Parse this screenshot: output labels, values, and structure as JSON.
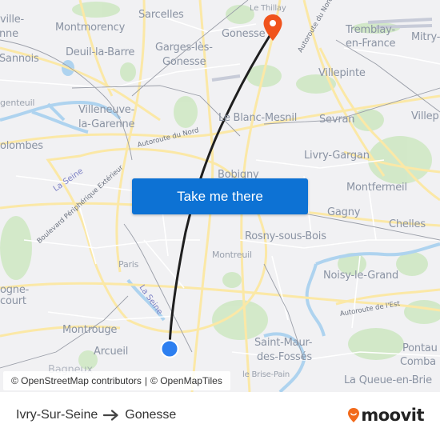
{
  "map": {
    "places": [
      {
        "id": "sarcelles",
        "label": "Sarcelles"
      },
      {
        "id": "montmorency",
        "label": "Montmorency"
      },
      {
        "id": "deuil",
        "label": "Deuil-la-Barre"
      },
      {
        "id": "garges1",
        "label": "Garges-lès-"
      },
      {
        "id": "garges2",
        "label": "Gonesse"
      },
      {
        "id": "sannois",
        "label": "Sannois"
      },
      {
        "id": "ville1",
        "label": "ville-"
      },
      {
        "id": "ville2",
        "label": "nne"
      },
      {
        "id": "argenteuil",
        "label": "genteuil"
      },
      {
        "id": "villeneuve1",
        "label": "Villeneuve-"
      },
      {
        "id": "villeneuve2",
        "label": "la-Garenne"
      },
      {
        "id": "colombes",
        "label": "olombes"
      },
      {
        "id": "lethillay",
        "label": "Le Thillay"
      },
      {
        "id": "gonesse",
        "label": "Gonesse"
      },
      {
        "id": "tremblay1",
        "label": "Tremblay-"
      },
      {
        "id": "tremblay2",
        "label": "en-France"
      },
      {
        "id": "mitry",
        "label": "Mitry-"
      },
      {
        "id": "villepinte",
        "label": "Villepinte"
      },
      {
        "id": "blancmesnil",
        "label": "Le Blanc-Mesnil"
      },
      {
        "id": "sevran",
        "label": "Sevran"
      },
      {
        "id": "villep",
        "label": "Villep"
      },
      {
        "id": "livry",
        "label": "Livry-Gargan"
      },
      {
        "id": "bobigny",
        "label": "Bobigny"
      },
      {
        "id": "montfermeil",
        "label": "Montfermeil"
      },
      {
        "id": "gagny",
        "label": "Gagny"
      },
      {
        "id": "chelles",
        "label": "Chelles"
      },
      {
        "id": "rosny",
        "label": "Rosny-sous-Bois"
      },
      {
        "id": "montreuil",
        "label": "Montreuil"
      },
      {
        "id": "paris",
        "label": "Paris"
      },
      {
        "id": "noisy",
        "label": "Noisy-le-Grand"
      },
      {
        "id": "boulogne1",
        "label": "ogne-"
      },
      {
        "id": "boulogne2",
        "label": "court"
      },
      {
        "id": "montrouge",
        "label": "Montrouge"
      },
      {
        "id": "arcueil",
        "label": "Arcueil"
      },
      {
        "id": "bagneux",
        "label": "Bagneux"
      },
      {
        "id": "saintmaur1",
        "label": "Saint-Maur-"
      },
      {
        "id": "saintmaur2",
        "label": "des-Fossés"
      },
      {
        "id": "brisepain",
        "label": "le Brise-Pain"
      },
      {
        "id": "pontault1",
        "label": "Pontau"
      },
      {
        "id": "pontault2",
        "label": "Comba"
      },
      {
        "id": "queue",
        "label": "La Queue-en-Brie"
      }
    ],
    "roads": {
      "autoroute_nord_1": "Autoroute du Nord",
      "autoroute_nord_2": "Autoroute du Nord",
      "autoroute_est": "Autoroute de l'Est",
      "peripherique": "Boulevard Périphérique Extérieur"
    },
    "rivers": {
      "seine_1": "La Seine",
      "seine_2": "La Seine"
    },
    "origin": {
      "name": "Ivry-Sur-Seine",
      "marker_color": "#2d7ff0"
    },
    "destination": {
      "name": "Gonesse",
      "marker_color": "#f0531c"
    }
  },
  "cta": {
    "label": "Take me there"
  },
  "attribution": {
    "osm": "© OpenStreetMap contributors",
    "separator": "|",
    "tiles": "© OpenMapTiles"
  },
  "footer": {
    "origin": "Ivry-Sur-Seine",
    "destination": "Gonesse",
    "brand": "moovit",
    "brand_color": "#f26a1b"
  }
}
